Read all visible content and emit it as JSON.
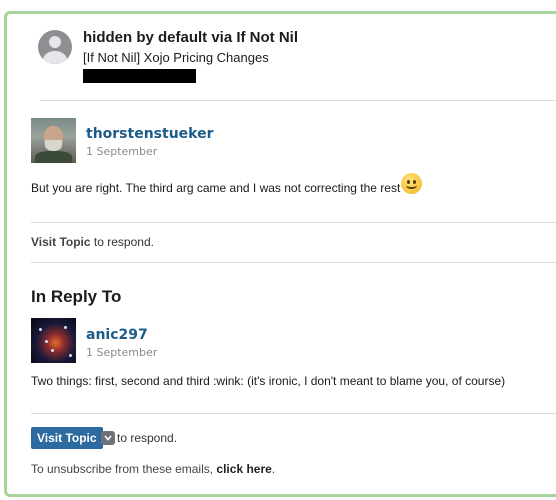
{
  "header": {
    "title": "hidden by default via If Not Nil",
    "subject": "[If Not Nil] Xojo Pricing Changes"
  },
  "post": {
    "username": "thorstenstueker",
    "date": "1 September",
    "text": "But you are right. The third arg came and I was not correcting the rest",
    "visit_link": "Visit Topic",
    "respond_text": " to respond."
  },
  "reply": {
    "heading": "In Reply To",
    "username": "anic297",
    "date": "1 September",
    "text": "Two things: first, second and third :wink: (it's ironic, I don't meant to blame you, of course)"
  },
  "footer": {
    "visit_button": "Visit Topic",
    "respond_text": "to respond.",
    "unsub_prefix": "To unsubscribe from these emails, ",
    "unsub_link": "click here",
    "unsub_suffix": "."
  },
  "colors": {
    "frame_border": "#a6d49a",
    "username": "#1d5c88",
    "button": "#2d6aa0"
  }
}
